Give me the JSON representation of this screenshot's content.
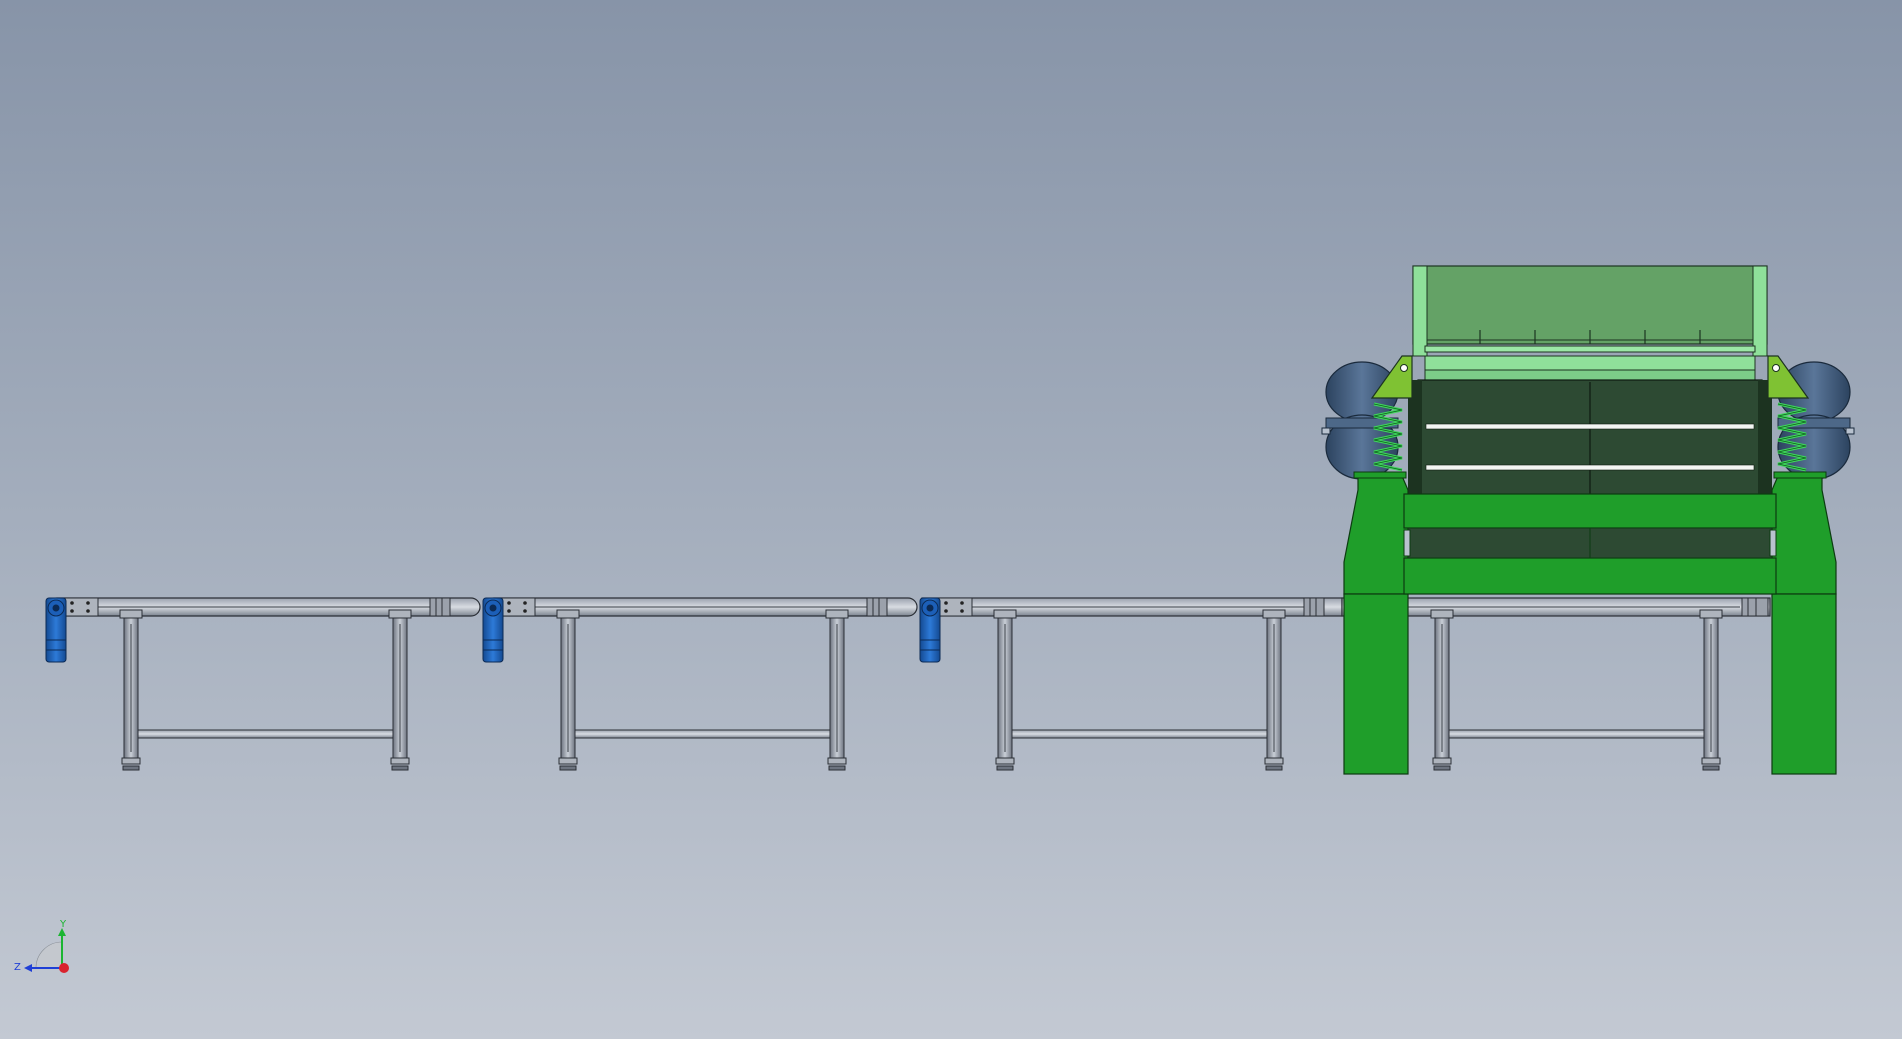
{
  "viewport": {
    "background_top": "#8794a8",
    "background_bottom": "#c3c9d3"
  },
  "model": {
    "conveyor_sections": 4,
    "drive_motors": 3,
    "frame_color": "#1f9e2a",
    "screen_deck_color": "#2d4a33",
    "hopper_color": "#64a266",
    "spring_color": "#3ed65a",
    "motor_color": "#1c5fb8",
    "vibrator_color": "#3e5a7a"
  },
  "triad": {
    "x_label": "",
    "y_label": "Y",
    "z_label": "Z",
    "x_color": "#d9232e",
    "y_color": "#1bb532",
    "z_color": "#1f3fd6"
  }
}
